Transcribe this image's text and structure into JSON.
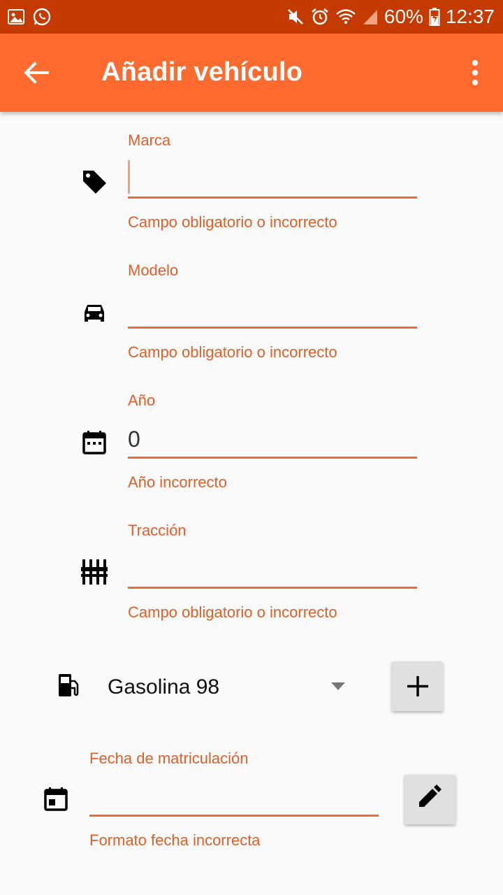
{
  "status_bar": {
    "battery": "60%",
    "time": "12:37"
  },
  "app_bar": {
    "title": "Añadir vehículo"
  },
  "fields": {
    "marca": {
      "label": "Marca",
      "value": "",
      "error": "Campo obligatorio o incorrecto"
    },
    "modelo": {
      "label": "Modelo",
      "value": "",
      "error": "Campo obligatorio o incorrecto"
    },
    "anio": {
      "label": "Año",
      "value": "0",
      "error": "Año incorrecto"
    },
    "traccion": {
      "label": "Tracción",
      "value": "",
      "error": "Campo obligatorio o incorrecto"
    }
  },
  "fuel": {
    "selected": "Gasolina 98"
  },
  "registration": {
    "label": "Fecha de matriculación",
    "value": "",
    "error": "Formato fecha incorrecta"
  },
  "icons": {
    "tag": "tag-icon",
    "car": "car-icon",
    "calendar": "calendar-icon",
    "traction": "tune-icon",
    "fuel": "gas-pump-icon",
    "event": "event-icon"
  },
  "colors": {
    "app_bar": "#ff6b2f",
    "status_bar": "#c43a00",
    "accent": "#e0602a"
  }
}
